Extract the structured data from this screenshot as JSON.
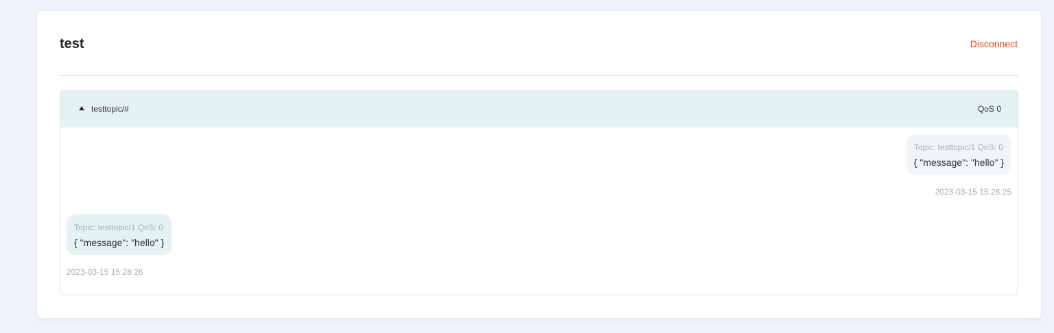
{
  "connection": {
    "name": "test",
    "disconnect_label": "Disconnect"
  },
  "subscription": {
    "topic": "testtopic/#",
    "qos": "QoS 0",
    "expanded": true
  },
  "messages": [
    {
      "direction": "outgoing",
      "meta": "Topic: testtopic/1 QoS: 0",
      "payload": "{ \"message\": \"hello\" }",
      "time": "2023-03-15 15:28:25"
    },
    {
      "direction": "incoming",
      "meta": "Topic: testtopic/1 QoS: 0",
      "payload": "{ \"message\": \"hello\" }",
      "time": "2023-03-15 15:28:26"
    }
  ],
  "colors": {
    "page_background": "#eff4fa",
    "accent_danger": "#e8420f",
    "subscription_header": "#e4f3f1",
    "outgoing_bubble": "#f1f4f8",
    "incoming_bubble": "#e4f3f1"
  }
}
